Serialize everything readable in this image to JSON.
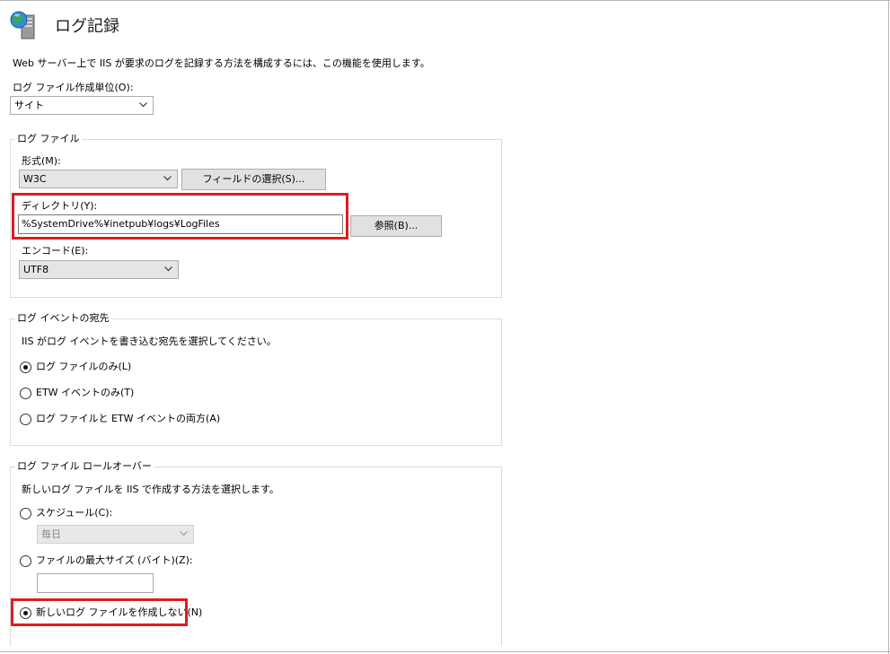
{
  "header": {
    "title": "ログ記録",
    "icon": "globe-server-icon"
  },
  "description": "Web サーバー上で IIS が要求のログを記録する方法を構成するには、この機能を使用します。",
  "log_unit": {
    "label": "ログ ファイル作成単位(O):",
    "value": "サイト"
  },
  "log_file": {
    "legend": "ログ ファイル",
    "format_label": "形式(M):",
    "format_value": "W3C",
    "select_fields_button": "フィールドの選択(S)...",
    "directory_label": "ディレクトリ(Y):",
    "directory_value": "%SystemDrive%¥inetpub¥logs¥LogFiles",
    "browse_button": "参照(B)...",
    "encoding_label": "エンコード(E):",
    "encoding_value": "UTF8"
  },
  "event_destination": {
    "legend": "ログ イベントの宛先",
    "description": "IIS がログ イベントを書き込む宛先を選択してください。",
    "options": [
      {
        "label": "ログ ファイルのみ(L)",
        "checked": true
      },
      {
        "label": "ETW イベントのみ(T)",
        "checked": false
      },
      {
        "label": "ログ ファイルと ETW イベントの両方(A)",
        "checked": false
      }
    ]
  },
  "rollover": {
    "legend": "ログ ファイル ロールオーバー",
    "description": "新しいログ ファイルを IIS で作成する方法を選択します。",
    "schedule_label": "スケジュール(C):",
    "schedule_value": "毎日",
    "max_size_label": "ファイルの最大サイズ (バイト)(Z):",
    "max_size_value": "",
    "no_new_file_label": "新しいログ ファイルを作成しない(N)",
    "selected": "no_new_file"
  },
  "colors": {
    "highlight": "#e01b24",
    "button_bg": "#e1e1e1",
    "group_border": "#dcdcdc"
  }
}
